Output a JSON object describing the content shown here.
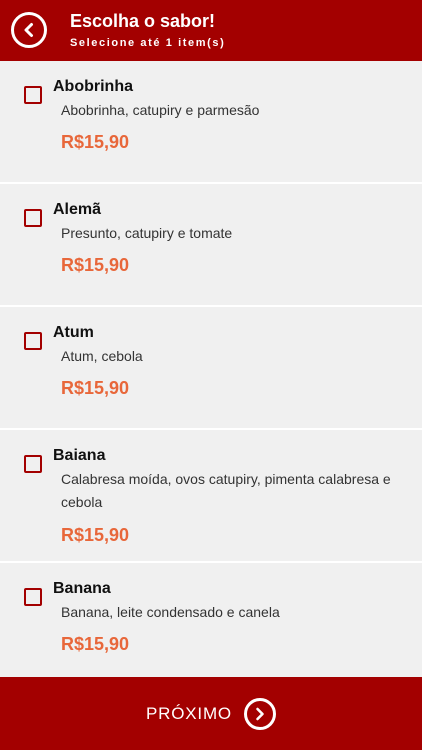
{
  "header": {
    "title": "Escolha o sabor!",
    "subtitle": "Selecione até 1 item(s)",
    "back_icon": "chevron-left-circle-icon",
    "background": "#a30000"
  },
  "items": [
    {
      "name": "Abobrinha",
      "description": "Abobrinha, catupiry e parmesão",
      "price": "R$15,90",
      "checked": false
    },
    {
      "name": "Alemã",
      "description": "Presunto, catupiry e tomate",
      "price": "R$15,90",
      "checked": false
    },
    {
      "name": "Atum",
      "description": "Atum, cebola",
      "price": "R$15,90",
      "checked": false
    },
    {
      "name": "Baiana",
      "description": "Calabresa moída, ovos catupiry, pimenta calabresa e cebola",
      "price": "R$15,90",
      "checked": false
    },
    {
      "name": "Banana",
      "description": "Banana, leite condensado e canela",
      "price": "R$15,90",
      "checked": false
    }
  ],
  "footer": {
    "next_label": "PRÓXIMO",
    "next_icon": "chevron-right-circle-icon"
  },
  "colors": {
    "brand": "#a30000",
    "price": "#e8673a",
    "list_background": "#f0f0f0"
  }
}
